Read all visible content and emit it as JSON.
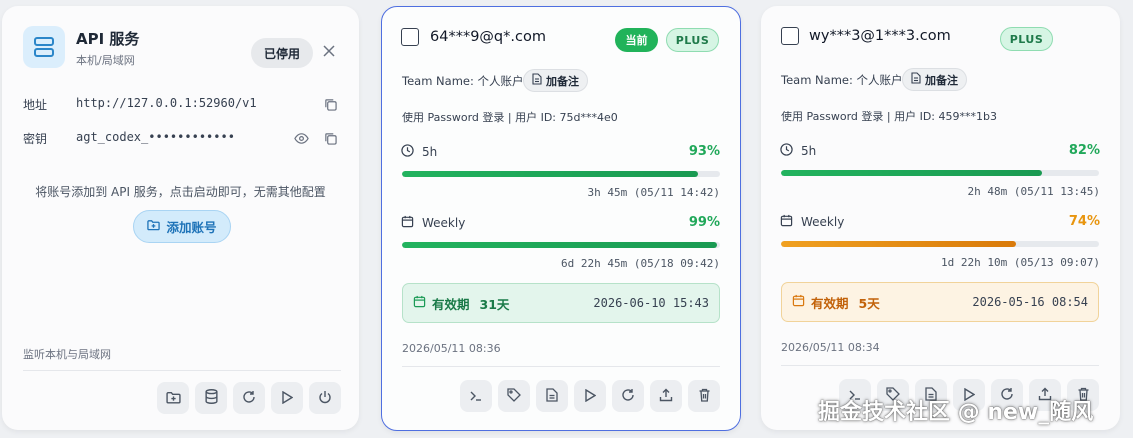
{
  "api_card": {
    "title": "API 服务",
    "subtitle": "本机/局域网",
    "status_button": "已停用",
    "address_label": "地址",
    "address_value": "http://127.0.0.1:52960/v1",
    "key_label": "密钥",
    "key_value": "agt_codex_••••••••••••",
    "hint": "将账号添加到 API 服务，点击启动即可，无需其他配置",
    "add_button": "添加账号",
    "listen_note": "监听本机与局域网",
    "toolbar_icons": [
      "folder-plus-icon",
      "database-icon",
      "refresh-icon",
      "play-icon",
      "power-icon"
    ]
  },
  "accounts": [
    {
      "email": "64***9@q*.com",
      "current_badge": "当前",
      "plan_badge": "PLUS",
      "team_name": "Team Name: 个人账户",
      "note_button": "加备注",
      "login_info": "使用 Password 登录 | 用户 ID: 75d***4e0",
      "usage": [
        {
          "label": "5h",
          "percent_text": "93%",
          "percent": 93,
          "color": "#21a85a",
          "reset": "3h 45m (05/11 14:42)"
        },
        {
          "label": "Weekly",
          "percent_text": "99%",
          "percent": 99,
          "color": "#21a85a",
          "reset": "6d 22h 45m (05/18 09:42)"
        }
      ],
      "expiry_label": "有效期",
      "expiry_days": "31天",
      "expiry_date": "2026-06-10 15:43",
      "created": "2026/05/11 08:36"
    },
    {
      "email": "wy***3@1***3.com",
      "plan_badge": "PLUS",
      "team_name": "Team Name: 个人账户",
      "note_button": "加备注",
      "login_info": "使用 Password 登录 | 用户 ID: 459***1b3",
      "usage": [
        {
          "label": "5h",
          "percent_text": "82%",
          "percent": 82,
          "color": "#21a85a",
          "reset": "2h 48m (05/11 13:45)"
        },
        {
          "label": "Weekly",
          "percent_text": "74%",
          "percent": 74,
          "color": "#e8950f",
          "reset": "1d 22h 10m (05/13 09:07)"
        }
      ],
      "expiry_label": "有效期",
      "expiry_days": "5天",
      "expiry_date": "2026-05-16 08:54",
      "created": "2026/05/11 08:34"
    }
  ],
  "account_toolbar_icons": [
    "terminal-icon",
    "tag-icon",
    "document-icon",
    "play-icon",
    "refresh-icon",
    "upload-icon",
    "trash-icon"
  ],
  "watermark": "掘金技术社区 @ new_随风",
  "colors": {
    "accent_blue": "#4f6fe0",
    "green": "#21a85a",
    "orange": "#e8950f"
  }
}
